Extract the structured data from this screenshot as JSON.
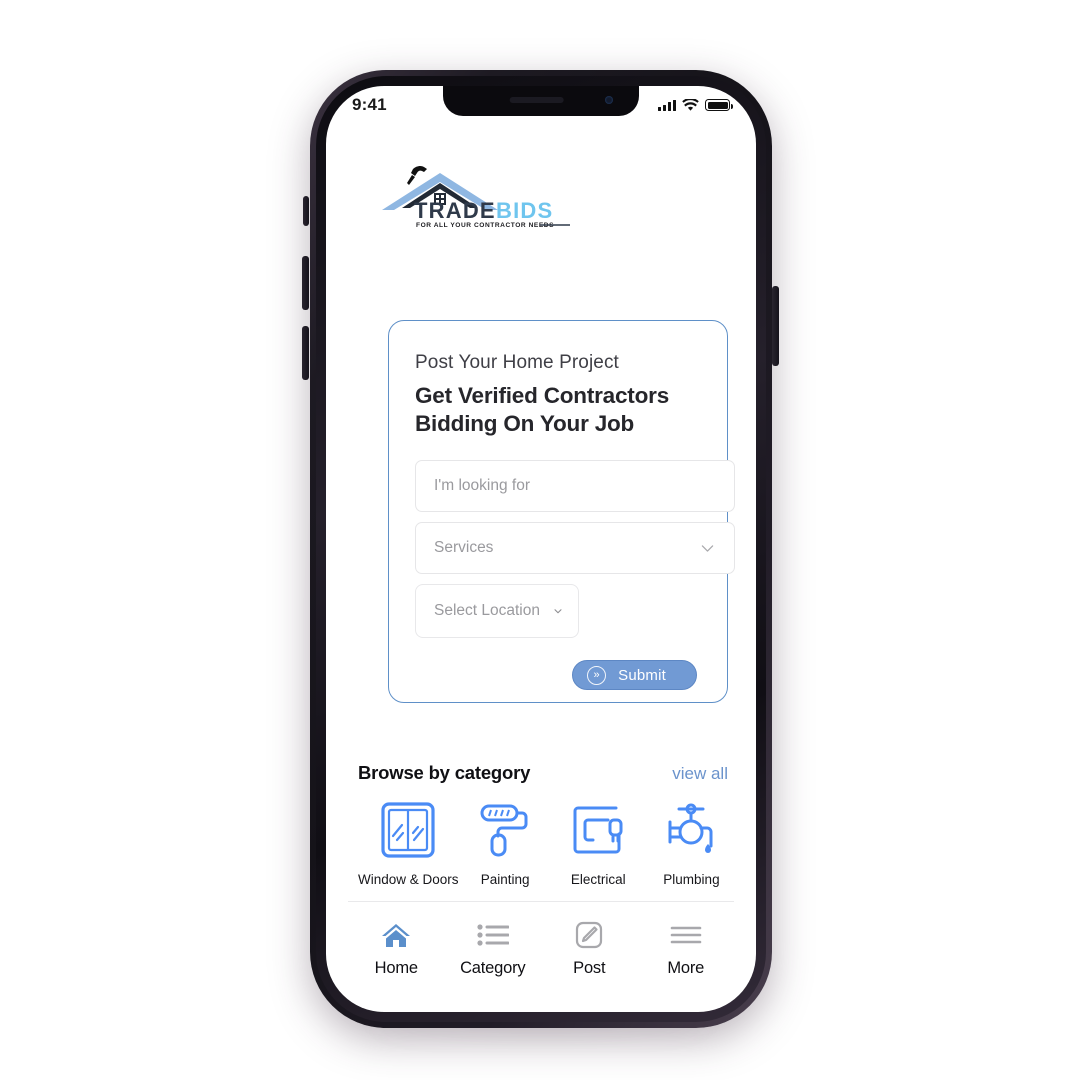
{
  "status_bar": {
    "time": "9:41",
    "signal_icon": "cellular-signal-icon",
    "wifi_icon": "wifi-icon",
    "battery_icon": "battery-icon"
  },
  "brand": {
    "name_part1": "TRADE",
    "name_part2": "BIDS",
    "tagline": "FOR ALL YOUR CONTRACTOR NEEDS",
    "logo_icon": "trade-bids-roof-hammer-logo",
    "color_dark": "#2f3a4a",
    "color_light": "#6fc5ee",
    "color_roof": "#7ca9dd"
  },
  "hero": {
    "eyebrow": "Post Your Home Project",
    "title_line1": "Get Verified Contractors",
    "title_line2": "Bidding On Your Job",
    "border_color": "#5f90c8",
    "fields": {
      "looking_for": {
        "placeholder": "I'm looking for",
        "value": ""
      },
      "services": {
        "placeholder": "Services",
        "value": "",
        "caret_icon": "chevron-down-icon"
      },
      "location": {
        "placeholder": "Select Location",
        "value": "",
        "caret_icon": "chevron-down-icon"
      }
    },
    "submit": {
      "label": "Submit",
      "icon": "chevron-double-right-icon",
      "bg_color": "#719ad4"
    }
  },
  "categories": {
    "title": "Browse by category",
    "view_all_label": "view all",
    "accent_color": "#4a8bf5",
    "items": [
      {
        "label": "Window & Doors",
        "icon": "window-icon"
      },
      {
        "label": "Painting",
        "icon": "paint-roller-icon"
      },
      {
        "label": "Electrical",
        "icon": "electrical-plug-icon"
      },
      {
        "label": "Plumbing",
        "icon": "faucet-icon"
      }
    ]
  },
  "tabbar": {
    "active_color": "#5b8fcb",
    "inactive_color": "#9b9b9f",
    "items": [
      {
        "label": "Home",
        "icon": "home-icon",
        "active": true
      },
      {
        "label": "Category",
        "icon": "list-icon",
        "active": false
      },
      {
        "label": "Post",
        "icon": "pencil-square-icon",
        "active": false
      },
      {
        "label": "More",
        "icon": "hamburger-menu-icon",
        "active": false
      }
    ]
  }
}
